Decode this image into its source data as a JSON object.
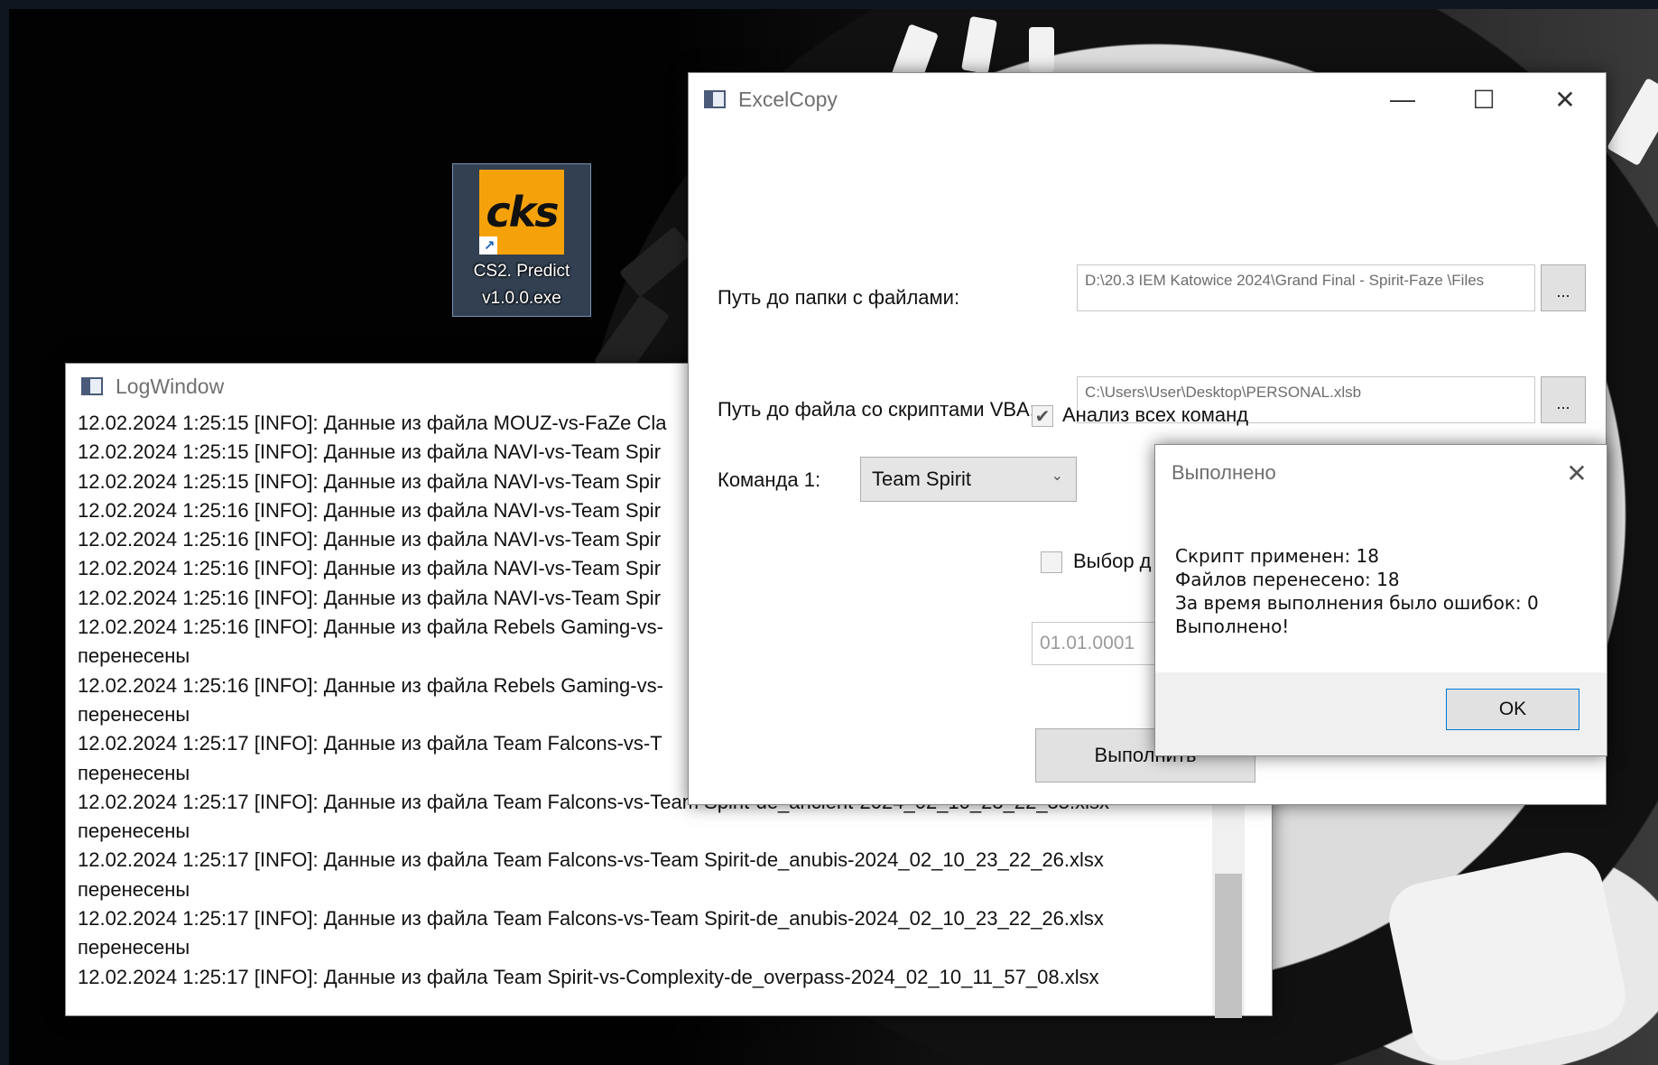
{
  "desktop": {
    "icon_logo_text": "cks",
    "icon_label_line1": "CS2. Predict",
    "icon_label_line2": "v1.0.0.exe"
  },
  "log_window": {
    "title": "LogWindow",
    "lines": [
      "12.02.2024 1:25:15 [INFO]: Данные из файла MOUZ-vs-FaZe Cla",
      "12.02.2024 1:25:15 [INFO]: Данные из файла NAVI-vs-Team Spir",
      "12.02.2024 1:25:15 [INFO]: Данные из файла NAVI-vs-Team Spir",
      "12.02.2024 1:25:16 [INFO]: Данные из файла NAVI-vs-Team Spir",
      "12.02.2024 1:25:16 [INFO]: Данные из файла NAVI-vs-Team Spir",
      "12.02.2024 1:25:16 [INFO]: Данные из файла NAVI-vs-Team Spir",
      "12.02.2024 1:25:16 [INFO]: Данные из файла NAVI-vs-Team Spir",
      "12.02.2024 1:25:16 [INFO]: Данные из файла Rebels Gaming-vs-",
      "перенесены",
      "12.02.2024 1:25:16 [INFO]: Данные из файла Rebels Gaming-vs-",
      "перенесены",
      "12.02.2024 1:25:17 [INFO]: Данные из файла Team Falcons-vs-T",
      "перенесены",
      "12.02.2024 1:25:17 [INFO]: Данные из файла Team Falcons-vs-Team Spirit-de_ancient-2024_02_10_23_22_35.xlsx",
      "перенесены",
      "12.02.2024 1:25:17 [INFO]: Данные из файла Team Falcons-vs-Team Spirit-de_anubis-2024_02_10_23_22_26.xlsx",
      "перенесены",
      "12.02.2024 1:25:17 [INFO]: Данные из файла Team Falcons-vs-Team Spirit-de_anubis-2024_02_10_23_22_26.xlsx",
      "перенесены",
      "12.02.2024 1:25:17 [INFO]: Данные из файла Team Spirit-vs-Complexity-de_overpass-2024_02_10_11_57_08.xlsx"
    ]
  },
  "main_window": {
    "title": "ExcelCopy",
    "folder_label": "Путь до папки с файлами:",
    "folder_value": "D:\\20.3 IEM Katowice 2024\\Grand Final - Spirit-Faze \\Files",
    "browse_label": "...",
    "vba_label": "Путь до файла со скриптами VBA:",
    "vba_value": "C:\\Users\\User\\Desktop\\PERSONAL.xlsb",
    "analyze_all_label": "Анализ всех команд",
    "analyze_all_checked": true,
    "team1_label": "Команда 1:",
    "team1_value": "Team Spirit",
    "date_select_label": "Выбор д",
    "date_value": "01.01.0001",
    "run_label": "Выполнить"
  },
  "message_box": {
    "title": "Выполнено",
    "lines": [
      "Скрипт применен: 18",
      "Файлов перенесено: 18",
      "За время выполнения было ошибок: 0",
      "Выполнено!"
    ],
    "ok_label": "OK"
  },
  "icons": {
    "minimize": "—",
    "maximize": "☐",
    "close": "✕",
    "check": "✔",
    "chevron": "⌄"
  }
}
